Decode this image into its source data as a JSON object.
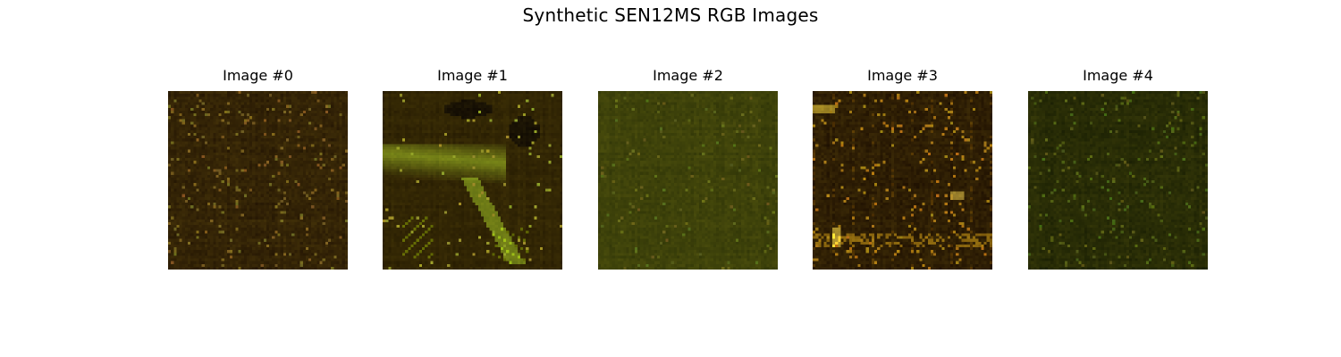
{
  "figure": {
    "title": "Synthetic SEN12MS RGB Images"
  },
  "panels": [
    {
      "title": "Image #0",
      "style": "speckled-dark-olive"
    },
    {
      "title": "Image #1",
      "style": "bright-blobs-structure"
    },
    {
      "title": "Image #2",
      "style": "uniform-olive-texture"
    },
    {
      "title": "Image #3",
      "style": "streaked-orange-highlights"
    },
    {
      "title": "Image #4",
      "style": "dark-green-speckle"
    }
  ]
}
